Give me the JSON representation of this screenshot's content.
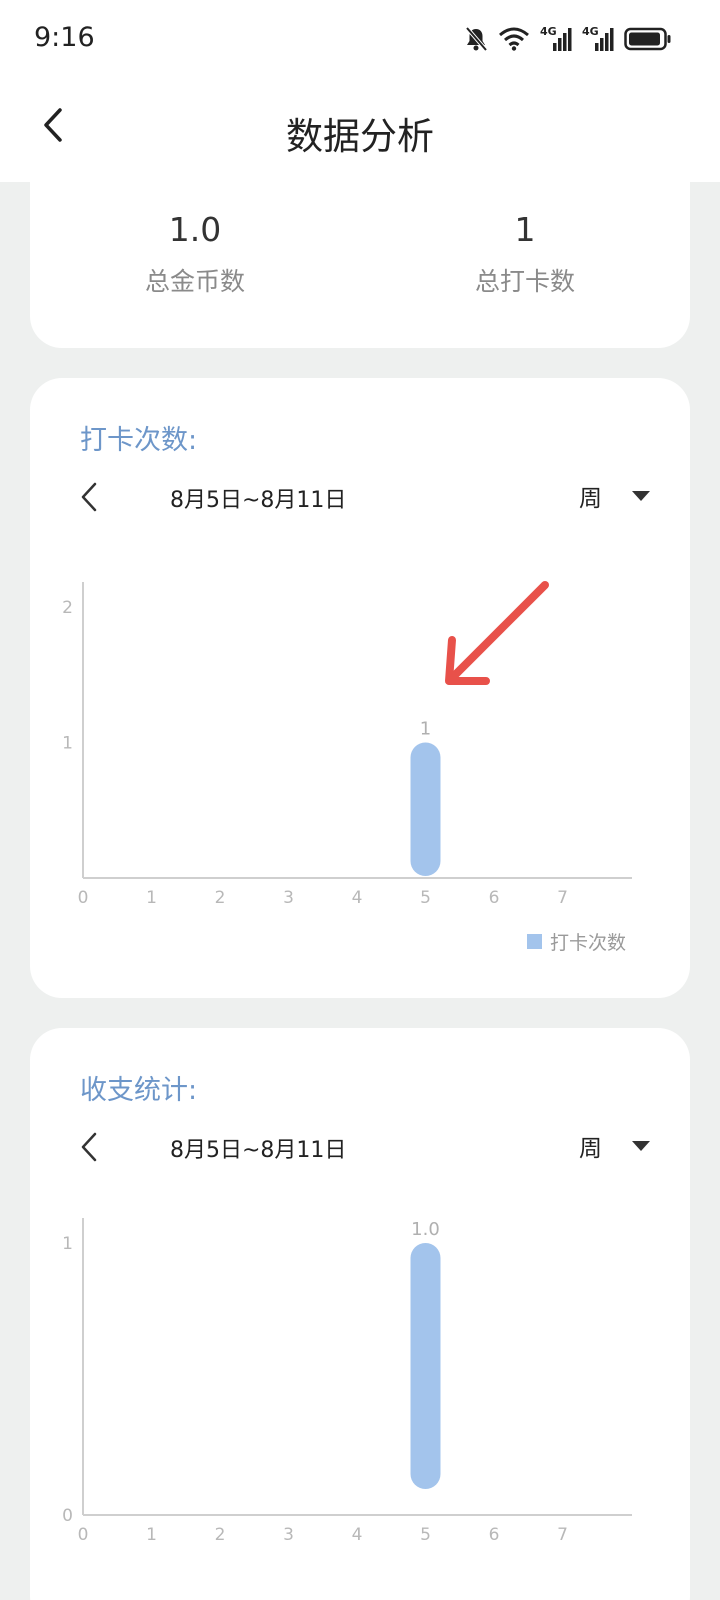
{
  "status_bar": {
    "time": "9:16",
    "icons": [
      "bell-muted-icon",
      "wifi-icon",
      "signal-4g-icon",
      "signal-4g-icon",
      "battery-icon"
    ],
    "network_label_1": "4G",
    "network_label_2": "4G"
  },
  "header": {
    "title": "数据分析",
    "back_icon": "chevron-left-icon"
  },
  "summary": {
    "total_coins_value": "1.0",
    "total_coins_label": "总金币数",
    "total_checkins_value": "1",
    "total_checkins_label": "总打卡数"
  },
  "checkin_card": {
    "title": "打卡次数:",
    "period_range": "8月5日~8月11日",
    "period_unit": "周",
    "legend_label": "打卡次数"
  },
  "finance_card": {
    "title": "收支统计:",
    "period_range": "8月5日~8月11日",
    "period_unit": "周"
  },
  "colors": {
    "bar": "#a3c4ec",
    "title_accent": "#6d96c9",
    "annotation_arrow": "#e8514a"
  },
  "chart_data": [
    {
      "type": "bar",
      "x": [
        0,
        1,
        2,
        3,
        4,
        5,
        6,
        7
      ],
      "values": [
        0,
        0,
        0,
        0,
        0,
        1,
        0,
        0
      ],
      "data_labels": {
        "5": "1"
      },
      "y_ticks": [
        "1",
        "2"
      ],
      "x_ticks": [
        "0",
        "1",
        "2",
        "3",
        "4",
        "5",
        "6",
        "7"
      ],
      "ylim": [
        0,
        2
      ],
      "xlim": [
        0,
        8
      ],
      "series": [
        {
          "name": "打卡次数",
          "values": [
            0,
            0,
            0,
            0,
            0,
            1,
            0,
            0
          ]
        }
      ],
      "legend": "bottom-right",
      "grid": false
    },
    {
      "type": "bar",
      "x": [
        0,
        1,
        2,
        3,
        4,
        5,
        6,
        7
      ],
      "values": [
        0,
        0,
        0,
        0,
        0,
        1.0,
        0,
        0
      ],
      "data_labels": {
        "5": "1.0"
      },
      "y_ticks": [
        "0",
        "1"
      ],
      "x_ticks": [
        "0",
        "1",
        "2",
        "3",
        "4",
        "5",
        "6",
        "7"
      ],
      "ylim": [
        0,
        1
      ],
      "xlim": [
        0,
        8
      ],
      "grid": false
    }
  ]
}
